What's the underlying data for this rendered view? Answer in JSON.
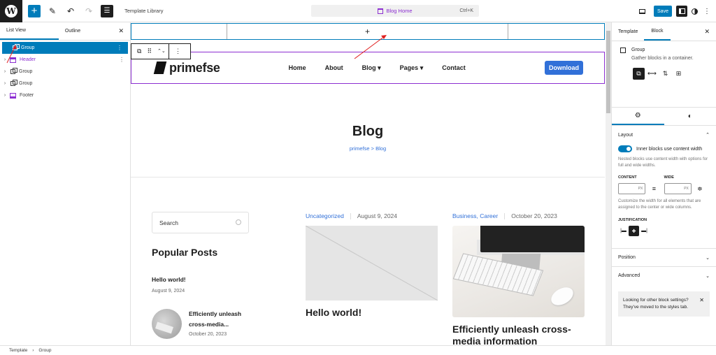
{
  "topbar": {
    "logo_glyph": "W",
    "add_glyph": "+",
    "edit_glyph": "✎",
    "undo_glyph": "↶",
    "redo_glyph": "↷",
    "list_glyph": "☰",
    "title": "Template Library",
    "command": {
      "label": "Blog Home",
      "shortcut": "Ctrl+K"
    },
    "save_label": "Save",
    "kebab_glyph": "⋮"
  },
  "left_panel": {
    "tabs": [
      {
        "label": "List View",
        "active": true
      },
      {
        "label": "Outline",
        "active": false
      }
    ],
    "close_glyph": "✕",
    "items": [
      {
        "label": "Group",
        "type": "group",
        "selected": true,
        "expand": ""
      },
      {
        "label": "Header",
        "type": "header",
        "selected": false,
        "expand": "›"
      },
      {
        "label": "Group",
        "type": "group",
        "selected": false,
        "expand": "›"
      },
      {
        "label": "Group",
        "type": "group",
        "selected": false,
        "expand": "›"
      },
      {
        "label": "Footer",
        "type": "footer",
        "selected": false,
        "expand": "›"
      }
    ],
    "more_glyph": "⋮"
  },
  "canvas": {
    "inserter_glyph": "+",
    "block_toolbar": {
      "parent_glyph": "⧉",
      "drag_glyph": "⠿",
      "move_glyph": "⌃⌄",
      "more_glyph": "⋮"
    },
    "site": {
      "logo_text": "primefse",
      "nav": [
        "Home",
        "About",
        "Blog ▾",
        "Pages ▾",
        "Contact"
      ],
      "cta": "Download"
    },
    "hero": {
      "title": "Blog",
      "breadcrumb": "primefse > Blog"
    },
    "sidebar": {
      "search_placeholder": "Search",
      "popular_title": "Popular Posts",
      "posts": [
        {
          "title": "Hello world!",
          "date": "August 9, 2024"
        },
        {
          "title": "Efficiently unleash cross-media...",
          "date": "October 20, 2023"
        }
      ]
    },
    "posts": [
      {
        "category": "Uncategorized",
        "date": "August 9, 2024",
        "title": "Hello world!"
      },
      {
        "category": "Business, Career",
        "date": "October 20, 2023",
        "title": "Efficiently unleash cross-media information"
      }
    ]
  },
  "right_panel": {
    "tabs": [
      {
        "label": "Template",
        "active": false
      },
      {
        "label": "Block",
        "active": true
      }
    ],
    "close_glyph": "✕",
    "block": {
      "name": "Group",
      "description": "Gather blocks in a container."
    },
    "variants": [
      "⧉",
      "⟷",
      "⇅",
      "⊞"
    ],
    "settings_tabs": [
      "⚙",
      "◐"
    ],
    "layout": {
      "title": "Layout",
      "toggle_label": "Inner blocks use content width",
      "toggle_on": true,
      "help": "Nested blocks use content width with options for full and wide widths.",
      "content_label": "CONTENT",
      "wide_label": "WIDE",
      "unit": "PX",
      "content_value": "",
      "wide_value": "",
      "width_help": "Customize the width for all elements that are assigned to the center or wide columns.",
      "justification_label": "JUSTIFICATION",
      "justification": [
        "|▬",
        "✚",
        "▬|"
      ],
      "justification_selected": 1
    },
    "sections": [
      "Position",
      "Advanced"
    ],
    "notice": "Looking for other block settings? They've moved to the styles tab."
  },
  "breadcrumb": [
    "Template",
    "Group"
  ],
  "colors": {
    "accent": "#007cba",
    "template_purple": "#8c2ed1",
    "site_blue": "#3170d8"
  }
}
